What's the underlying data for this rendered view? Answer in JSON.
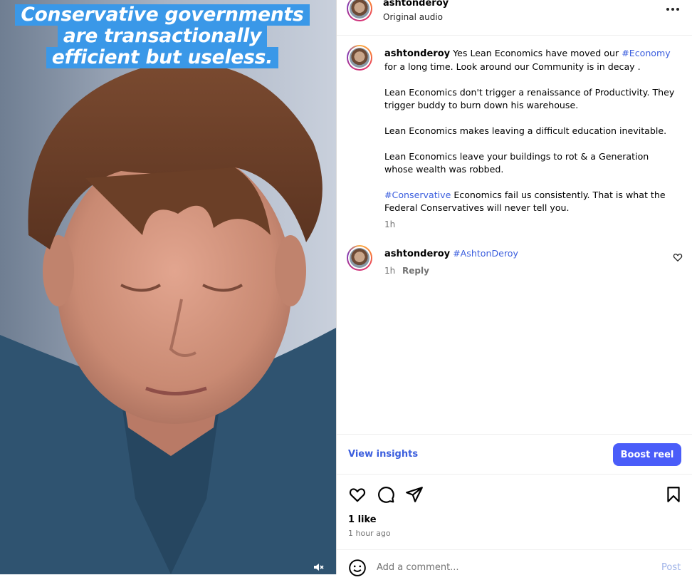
{
  "video": {
    "caption_lines": [
      "Conservative governments",
      "are transactionally",
      "efficient but useless."
    ],
    "mute_icon": "speaker-muted-icon"
  },
  "header": {
    "username": "ashtonderoy",
    "audio": "Original audio",
    "more_icon": "more-options-icon"
  },
  "caption": {
    "username": "ashtonderoy",
    "intro": "Yes Lean Economics have moved our ",
    "hashtag1": "#Economy",
    "intro_rest": " for a long time. Look around our Community is in decay .",
    "p2": "Lean Economics don't trigger a renaissance of Productivity. They trigger buddy to burn down his warehouse.",
    "p3": "Lean Economics makes leaving a difficult education inevitable.",
    "p4": "Lean Economics leave your buildings to rot & a Generation whose wealth was robbed.",
    "hashtag2": "#Conservative",
    "p5_rest": " Economics fail us consistently. That is what the Federal Conservatives will never tell you.",
    "time": "1h"
  },
  "comment": {
    "username": "ashtonderoy",
    "hashtag": "#AshtonDeroy",
    "time": "1h",
    "reply": "Reply"
  },
  "actions": {
    "view_insights": "View insights",
    "boost": "Boost reel",
    "likes": "1 like",
    "posted": "1 hour ago"
  },
  "composer": {
    "placeholder": "Add a comment...",
    "post": "Post"
  },
  "colors": {
    "accent": "#3b5ede",
    "boost_button": "#4a5df9",
    "caption_bg": "#3a98e8"
  }
}
